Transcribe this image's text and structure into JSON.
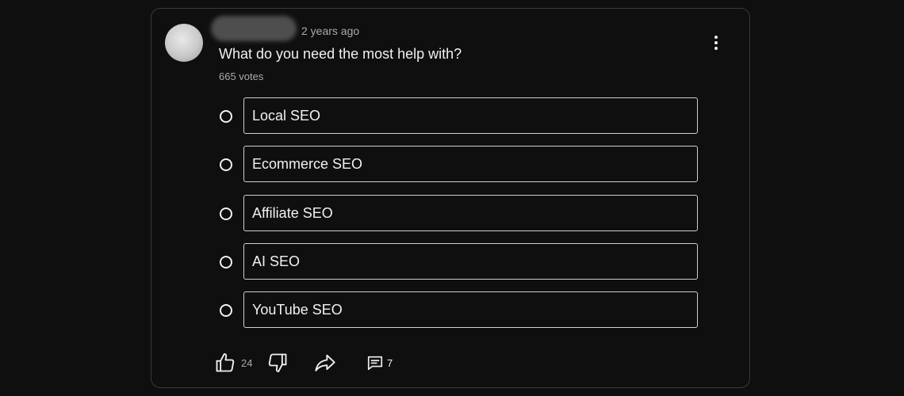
{
  "post": {
    "timestamp": "2 years ago",
    "question": "What do you need the most help with?",
    "votes": "665 votes"
  },
  "poll": {
    "options": [
      {
        "label": "Local SEO"
      },
      {
        "label": "Ecommerce SEO"
      },
      {
        "label": "Affiliate SEO"
      },
      {
        "label": "AI SEO"
      },
      {
        "label": "YouTube SEO"
      }
    ]
  },
  "actions": {
    "like_count": "24",
    "comment_count": "7",
    "icons": [
      "thumbs-up-icon",
      "thumbs-down-icon",
      "share-icon",
      "comment-icon",
      "more-vert-icon"
    ]
  },
  "colors": {
    "background": "#0f0f0f",
    "card_border": "#3a3a3a",
    "text_primary": "#f1f1f1",
    "text_secondary": "#aaaaaa"
  }
}
